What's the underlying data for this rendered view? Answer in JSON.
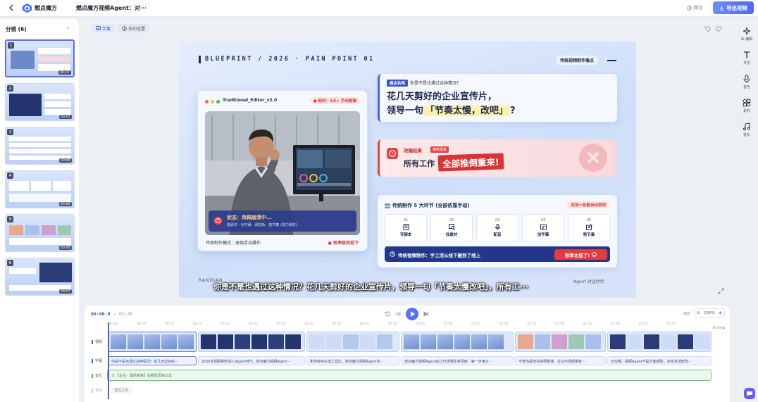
{
  "app": {
    "brand": "燃点魔方",
    "project_title": "燃点魔方视频Agent：对···",
    "save_label": "保存",
    "export_label": "导出视频",
    "accent_color": "#4f66f2"
  },
  "storyboard": {
    "header": "分镜 (6)",
    "collapse_icon": "double-chevron-left-icon",
    "items": [
      {
        "num": "1",
        "duration": "00:07",
        "selected": true
      },
      {
        "num": "2",
        "duration": "00:07",
        "selected": false
      },
      {
        "num": "3",
        "duration": "00:06",
        "selected": false
      },
      {
        "num": "4",
        "duration": "00:08",
        "selected": false
      },
      {
        "num": "5",
        "duration": "00:08",
        "selected": false
      },
      {
        "num": "6",
        "duration": "00:07",
        "selected": false
      }
    ]
  },
  "editor_tabs": [
    {
      "label": "字幕",
      "active": true
    },
    {
      "label": "水印设置",
      "active": false
    }
  ],
  "slide": {
    "blueprint_title": "BLUEPRINT / 2026 · PAIN POINT 01",
    "top_tag": "传统视频制作痛点",
    "editor_window": {
      "title": "Traditional_Editor_v2.0",
      "time_badge": "● 耗时：2天+ 手动剪辑",
      "status_title": "状态：改稿崩溃中...",
      "status_detail": "拖素材 · 对字幕 · 调音轨 · 剪节奏 (费力费时)",
      "mode_label": "传统制作模式：逐帧手动操作",
      "loss_label": "● 效率极其低下"
    },
    "pain_card": {
      "label": "痛点共鸣",
      "question": "你是不是也遇过这种情况?",
      "line1": "花几天剪好的企业宣传片，",
      "line2_prefix": "领导一句",
      "line2_highlight": "「节奏太慢，改吧」",
      "line2_suffix": "?"
    },
    "result_card": {
      "label": "改稿结果",
      "label2": "推倒重做",
      "text": "所有工作",
      "stamp": "全部推倒重来!"
    },
    "process_card": {
      "title": "传统制作 5 大环节 (全部依靠手动)",
      "warning": "没有一处能自动协同",
      "steps": [
        {
          "num": "01",
          "label": "写脚本",
          "icon": "script-icon"
        },
        {
          "num": "02",
          "label": "找素材",
          "icon": "search-media-icon"
        },
        {
          "num": "03",
          "label": "配音",
          "icon": "microphone-icon"
        },
        {
          "num": "04",
          "label": "加字幕",
          "icon": "caption-icon"
        },
        {
          "num": "05",
          "label": "剪节奏",
          "icon": "edit-rhythm-icon"
        }
      ],
      "bar_text": "传统视频制作：手工活从线下搬到了线上",
      "bar_button": "效率太低了!"
    },
    "footer_left": "RANDIAN",
    "footer_right": "Agent 对话时代",
    "subtitle": "你是不是也遇过这种情况？花几天剪好的企业宣传片，领导一句「节奏太慢改吧」，所有工···"
  },
  "right_tools": [
    {
      "label": "AI 编辑",
      "icon": "sparkle-icon"
    },
    {
      "label": "文字",
      "icon": "text-icon"
    },
    {
      "label": "音色",
      "icon": "microphone-icon"
    },
    {
      "label": "素材",
      "icon": "media-grid-icon"
    },
    {
      "label": "音乐",
      "icon": "music-note-icon"
    }
  ],
  "timeline": {
    "current_time": "00:00.0",
    "total_time": "/ 01:45",
    "zoom_label": "缩放",
    "zoom_value": "100%",
    "ruler_ticks": [
      "00:00",
      "00:05",
      "00:10",
      "00:15",
      "00:20",
      "00:25",
      "00:30",
      "00:35",
      "00:40",
      "00:45",
      "00:50",
      "00:55",
      "01:00",
      "01:05",
      "01:10",
      "01:15",
      "01:20",
      "01:25",
      "01:30",
      "01:35",
      "01:40"
    ],
    "ending_label": "Ending",
    "tracks": {
      "video": "视频",
      "subtitle": "字幕",
      "music": "音乐",
      "sfx": "音效"
    },
    "subtitle_clips": [
      "你是不是也遇过这种情况？花几天剪好的···",
      "2026年视频制作进入Agent时代。燃点魔方视频Agent···",
      "和传统AI生成工具比，燃点魔方视频Agent优···",
      "燃点魔方视频Agent的工作逻辑非常清晰：第一步用大···",
      "不管你是培训讲师做课，企业市场部做宣···",
      "记住哦，视频Agent不是万能钥匙，多轮对话修改···"
    ],
    "music_clip": "【企业 · 激昂奋进】征服星辰浪云去",
    "add_label": "音效上传"
  }
}
